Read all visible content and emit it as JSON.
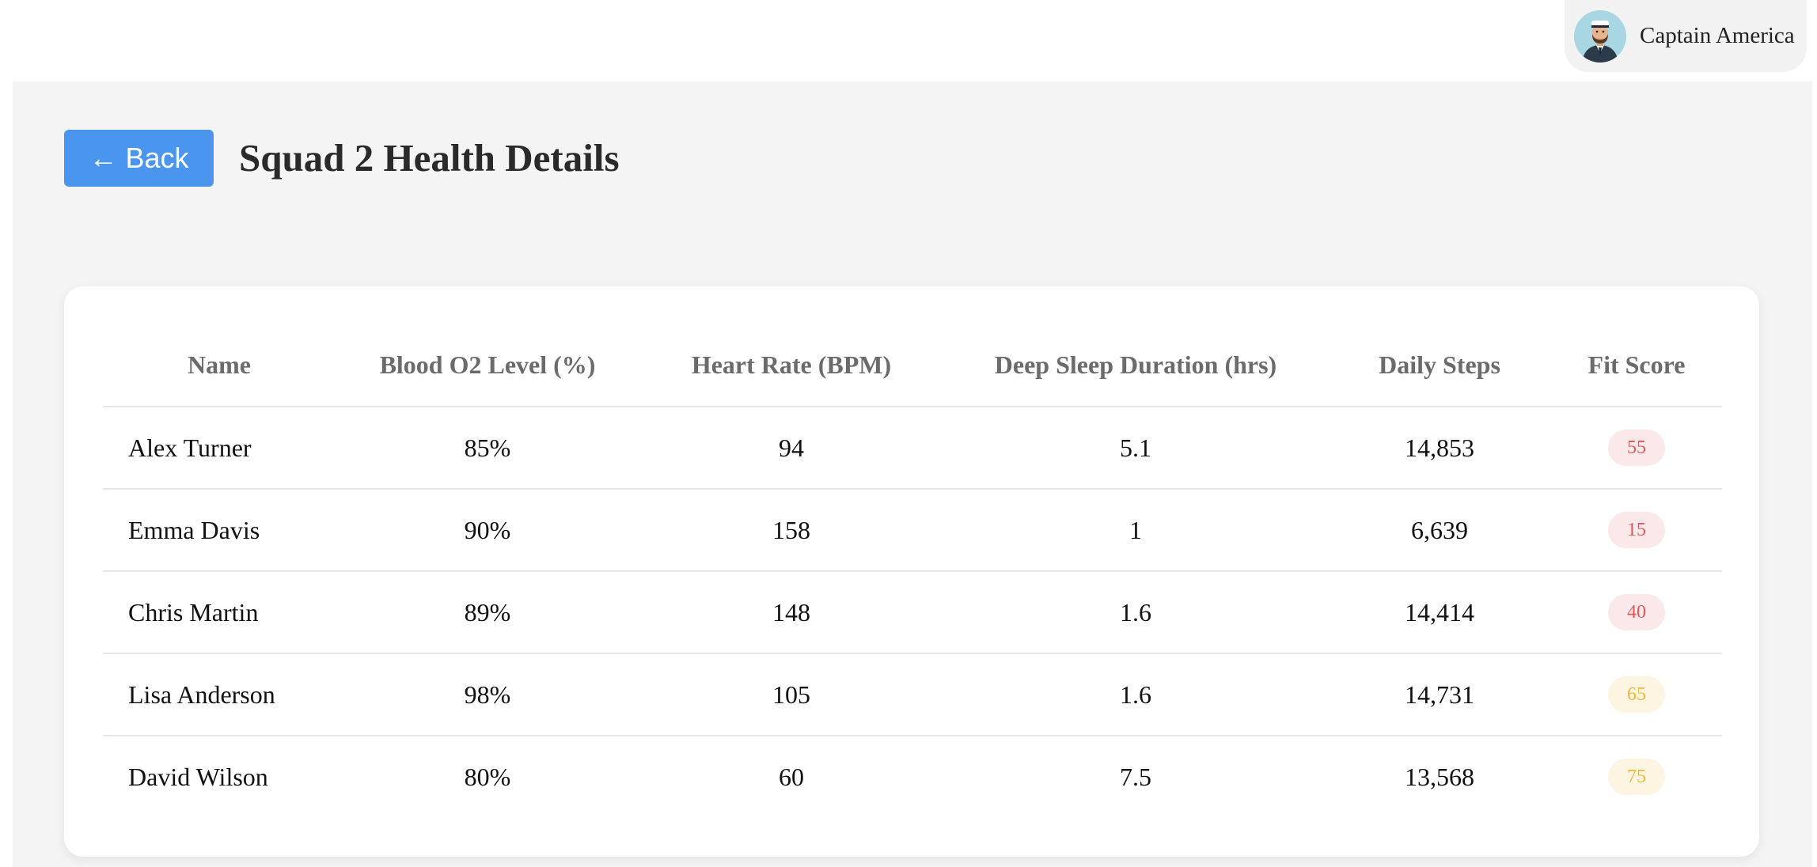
{
  "user": {
    "name": "Captain America",
    "avatar_icon": "avatar-icon"
  },
  "page": {
    "back_label": "← Back",
    "title": "Squad 2 Health Details"
  },
  "table": {
    "headers": [
      "Name",
      "Blood O2 Level (%)",
      "Heart Rate (BPM)",
      "Deep Sleep Duration (hrs)",
      "Daily Steps",
      "Fit Score"
    ],
    "rows": [
      {
        "name": "Alex Turner",
        "o2": "85%",
        "heart_rate": "94",
        "deep_sleep": "5.1",
        "steps": "14,853",
        "fit_score": "55",
        "score_level": "low"
      },
      {
        "name": "Emma Davis",
        "o2": "90%",
        "heart_rate": "158",
        "deep_sleep": "1",
        "steps": "6,639",
        "fit_score": "15",
        "score_level": "low"
      },
      {
        "name": "Chris Martin",
        "o2": "89%",
        "heart_rate": "148",
        "deep_sleep": "1.6",
        "steps": "14,414",
        "fit_score": "40",
        "score_level": "low"
      },
      {
        "name": "Lisa Anderson",
        "o2": "98%",
        "heart_rate": "105",
        "deep_sleep": "1.6",
        "steps": "14,731",
        "fit_score": "65",
        "score_level": "mid"
      },
      {
        "name": "David Wilson",
        "o2": "80%",
        "heart_rate": "60",
        "deep_sleep": "7.5",
        "steps": "13,568",
        "fit_score": "75",
        "score_level": "mid"
      }
    ]
  },
  "colors": {
    "accent": "#4a95ee",
    "score_low_bg": "#fbe9ea",
    "score_low_text": "#e0585a",
    "score_mid_bg": "#fdf4e2",
    "score_mid_text": "#f1b93a"
  }
}
